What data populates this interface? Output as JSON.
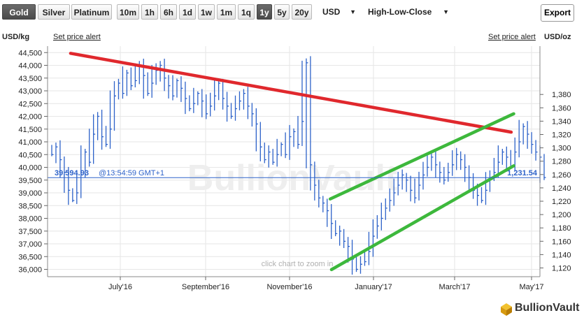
{
  "toolbar": {
    "metals": [
      {
        "label": "Gold",
        "active": true
      },
      {
        "label": "Silver",
        "active": false
      },
      {
        "label": "Platinum",
        "active": false
      }
    ],
    "ranges": [
      {
        "label": "10m",
        "active": false
      },
      {
        "label": "1h",
        "active": false
      },
      {
        "label": "6h",
        "active": false
      },
      {
        "label": "1d",
        "active": false
      },
      {
        "label": "1w",
        "active": false
      },
      {
        "label": "1m",
        "active": false
      },
      {
        "label": "1q",
        "active": false
      },
      {
        "label": "1y",
        "active": true
      },
      {
        "label": "5y",
        "active": false
      },
      {
        "label": "20y",
        "active": false
      }
    ],
    "currency": "USD",
    "chart_style": "High-Low-Close",
    "export_label": "Export"
  },
  "left_unit": "USD/kg",
  "right_unit": "USD/oz",
  "set_price_alert_left": "Set price alert",
  "set_price_alert_right": "Set price alert",
  "watermark": "BullionVault",
  "hint": "click chart to zoom in",
  "current_left_label": "39,594.93",
  "current_time_label": "@13:54:59 GMT+1",
  "current_right_label": "1,231.54",
  "logo_text": "BullionVault",
  "colors": {
    "series": "#2d62c9",
    "resistance": "#e0282d",
    "channel": "#3db83c",
    "active_button": "#555555",
    "axis": "#666666"
  },
  "chart_data": {
    "type": "high-low-close",
    "xlabels": [
      "July'16",
      "September'16",
      "November'16",
      "January'17",
      "March'17",
      "May'17"
    ],
    "left_axis": {
      "label": "USD/kg",
      "ticks": [
        "36,000",
        "36,500",
        "37,000",
        "37,500",
        "38,000",
        "38,500",
        "39,000",
        "39,500",
        "40,000",
        "40,500",
        "41,000",
        "41,500",
        "42,000",
        "42,500",
        "43,000",
        "43,500",
        "44,000",
        "44,500"
      ],
      "range": [
        35800,
        44700
      ]
    },
    "right_axis": {
      "label": "USD/oz",
      "ticks": [
        "1,120",
        "1,140",
        "1,160",
        "1,180",
        "1,200",
        "1,220",
        "1,240",
        "1,260",
        "1,280",
        "1,300",
        "1,320",
        "1,340",
        "1,360",
        "1,380"
      ],
      "range": [
        1113.5,
        1390.3
      ]
    },
    "close_series_usd_kg": [
      40500,
      40800,
      40300,
      39800,
      39100,
      38700,
      39000,
      39700,
      40600,
      40200,
      41300,
      42000,
      41200,
      40900,
      41500,
      42800,
      43300,
      42900,
      43700,
      43200,
      43400,
      44000,
      43600,
      42900,
      43300,
      43800,
      44000,
      43500,
      43200,
      42800,
      43400,
      43100,
      42700,
      42300,
      42500,
      42900,
      42600,
      42100,
      42400,
      42800,
      43300,
      42700,
      42400,
      42000,
      42300,
      42600,
      42900,
      42400,
      42100,
      41700,
      40800,
      40300,
      40600,
      40200,
      40500,
      40900,
      40500,
      41200,
      41400,
      40900,
      41800,
      44100,
      40100,
      39300,
      38800,
      38600,
      38300,
      37800,
      37400,
      37500,
      37100,
      36900,
      36400,
      36000,
      36200,
      36300,
      36700,
      37300,
      37700,
      38000,
      38400,
      38700,
      39000,
      39300,
      39700,
      39500,
      39100,
      38800,
      39300,
      39700,
      40000,
      40400,
      40100,
      39800,
      39500,
      39800,
      40100,
      40500,
      40300,
      40000,
      39600,
      39100,
      38900,
      38700,
      39100,
      39600,
      39800,
      40200,
      40600,
      40400,
      40000,
      40600,
      41000,
      41600,
      41300,
      40900,
      40600,
      40400,
      39600
    ],
    "last_price": {
      "usd_kg": 39594.93,
      "usd_oz": 1231.54,
      "time": "13:54:59 GMT+1"
    },
    "trendlines": [
      {
        "name": "resistance",
        "color": "#e0282d",
        "from": {
          "date": "2016-05-20",
          "usd_kg": 44470
        },
        "to": {
          "date": "2017-05-08",
          "usd_kg": 41380
        }
      },
      {
        "name": "channel_upper",
        "color": "#3db83c",
        "from": {
          "date": "2016-12-14",
          "usd_kg": 38760
        },
        "to": {
          "date": "2017-05-10",
          "usd_kg": 42100
        }
      },
      {
        "name": "channel_lower",
        "color": "#3db83c",
        "from": {
          "date": "2016-12-15",
          "usd_kg": 35990
        },
        "to": {
          "date": "2017-05-10",
          "usd_kg": 40060
        }
      }
    ],
    "grid": true,
    "legend": "none"
  }
}
